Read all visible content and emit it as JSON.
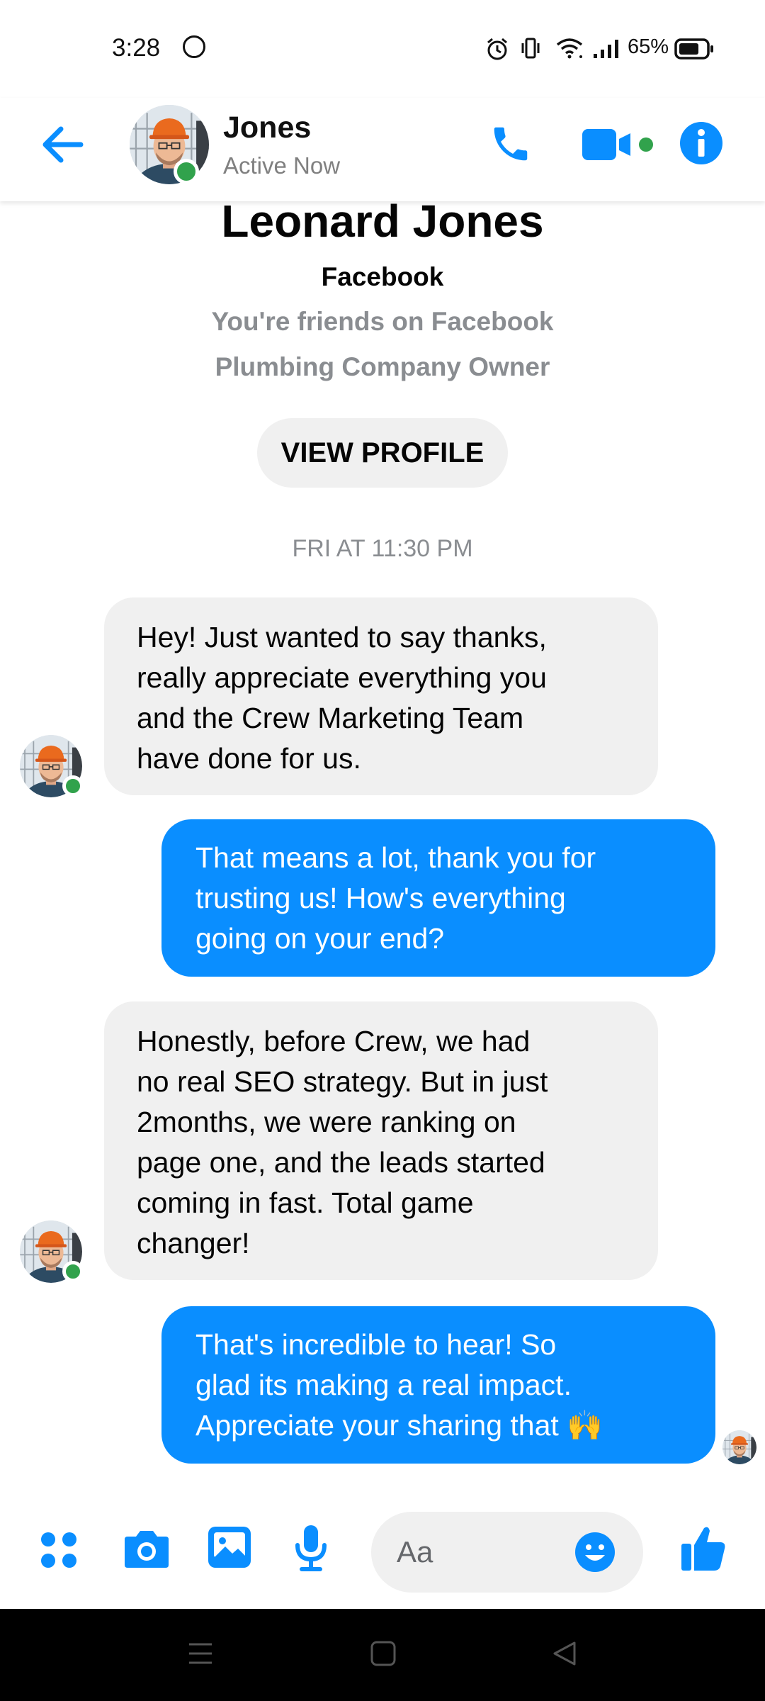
{
  "status_bar": {
    "time": "3:28",
    "battery": "65%",
    "icons": [
      "whatsapp-icon",
      "alarm-icon",
      "vibrate-icon",
      "wifi-icon",
      "signal-icon",
      "battery-icon"
    ]
  },
  "header": {
    "contact_name": "Jones",
    "presence": "Active Now",
    "icons": [
      "back-arrow-icon",
      "phone-icon",
      "video-icon",
      "info-icon"
    ]
  },
  "profile": {
    "full_name": "Leonard Jones",
    "platform": "Facebook",
    "relationship": "You're friends on Facebook",
    "occupation": "Plumbing Company Owner",
    "view_profile_label": "VIEW PROFILE"
  },
  "thread": {
    "timestamp": "FRI AT 11:30 PM",
    "messages": [
      {
        "sender": "contact",
        "lines": [
          "Hey! Just wanted to say thanks,",
          "really appreciate everything you",
          "and the Crew Marketing Team",
          "have done for us."
        ]
      },
      {
        "sender": "me",
        "lines": [
          "That means a lot, thank you for",
          "trusting us! How's everything",
          "going on your end?"
        ]
      },
      {
        "sender": "contact",
        "lines": [
          "Honestly, before Crew, we had",
          "no real SEO strategy. But in just",
          "2months, we were ranking on",
          "page one, and the leads started",
          "coming in fast. Total game",
          "changer!"
        ]
      },
      {
        "sender": "me",
        "lines": [
          "That's incredible to hear! So",
          "glad its making a real impact.",
          "Appreciate your sharing that 🙌"
        ]
      }
    ]
  },
  "composer": {
    "placeholder": "Aa",
    "icons": [
      "apps-icon",
      "camera-icon",
      "gallery-icon",
      "microphone-icon",
      "emoji-icon",
      "thumbs-up-icon"
    ]
  },
  "colors": {
    "messenger_blue": "#0a8eff",
    "incoming_bubble": "#f0f0f0",
    "online_green": "#31a24c"
  }
}
